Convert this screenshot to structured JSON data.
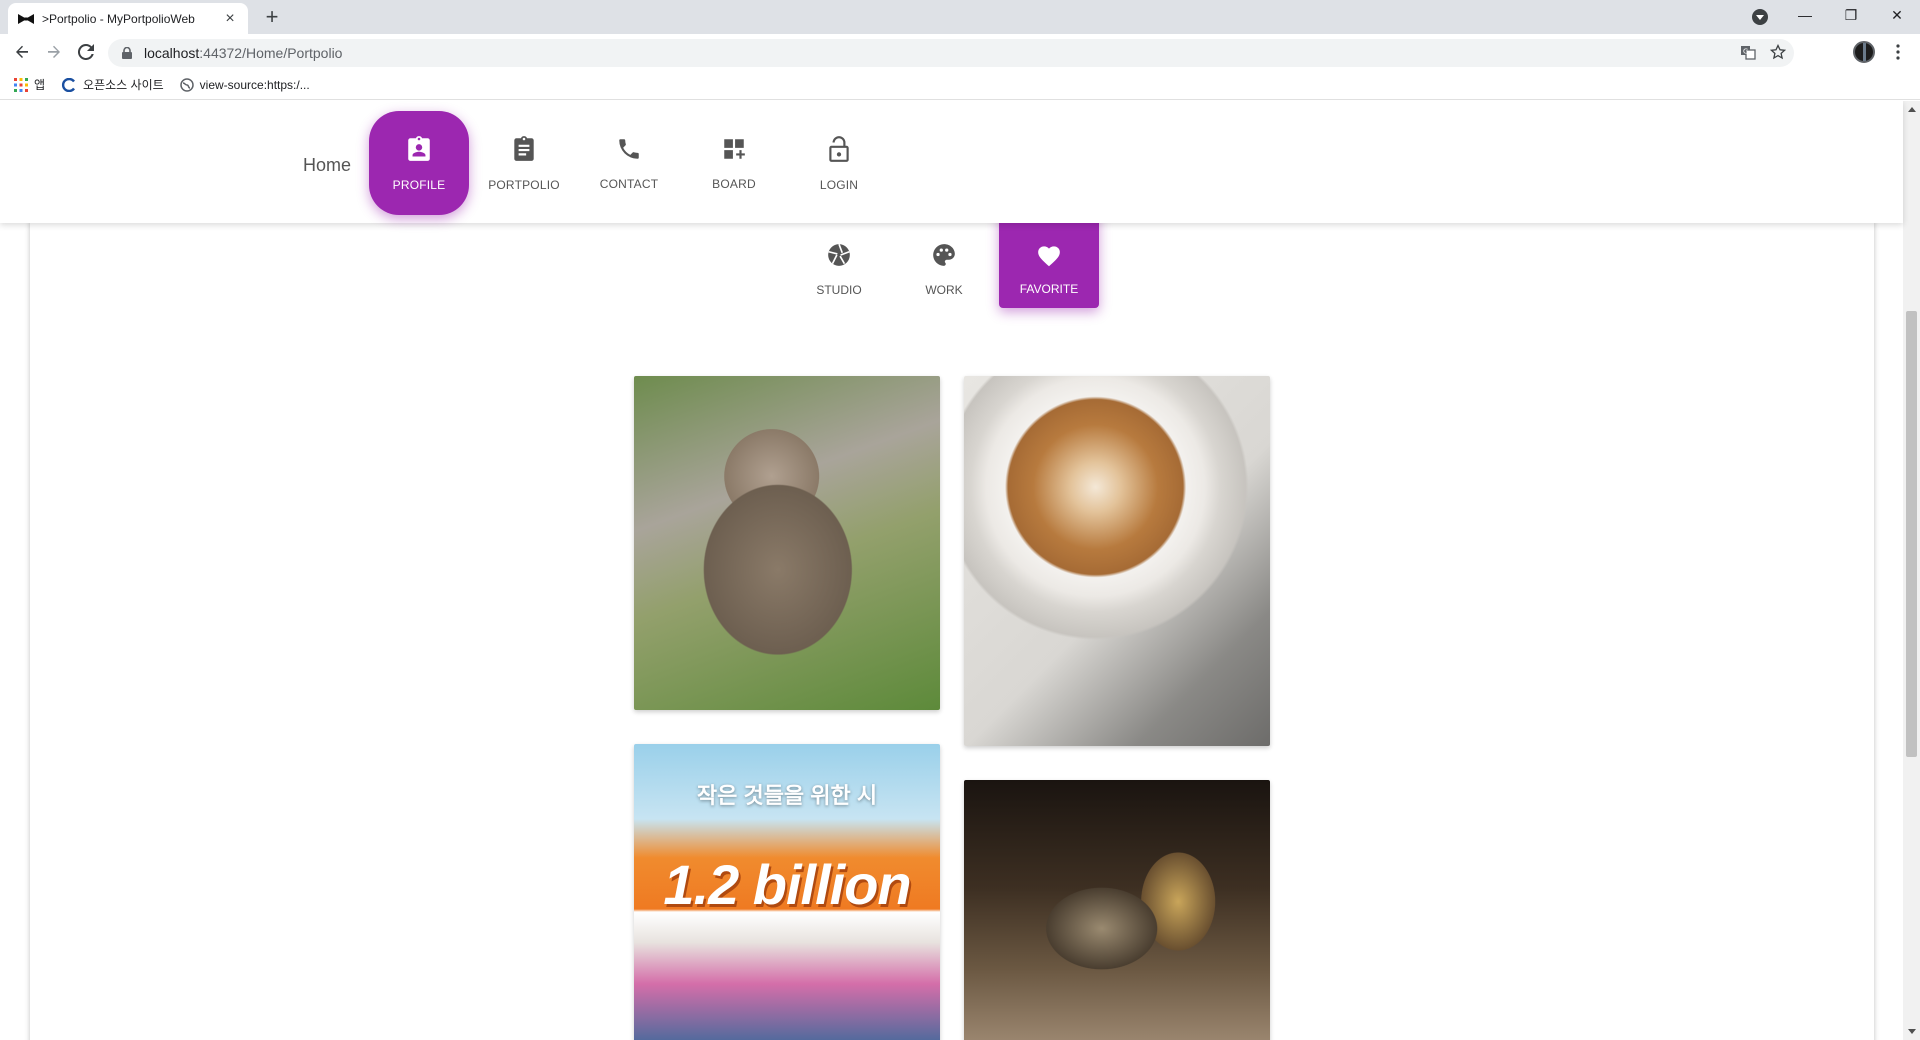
{
  "browser": {
    "tab_title": ">Portpolio - MyPortpolioWeb",
    "url_host": "localhost",
    "url_rest": ":44372/Home/Portpolio",
    "bookmarks": [
      "앱",
      "오픈소스 사이트",
      "view-source:https:/..."
    ]
  },
  "nav": {
    "home": "Home",
    "items": [
      {
        "label": "PROFILE",
        "icon": "contact-badge-icon",
        "active": true
      },
      {
        "label": "PORTPOLIO",
        "icon": "clipboard-icon",
        "active": false
      },
      {
        "label": "CONTACT",
        "icon": "phone-icon",
        "active": false
      },
      {
        "label": "BOARD",
        "icon": "dashboard-add-icon",
        "active": false
      },
      {
        "label": "LOGIN",
        "icon": "lock-open-icon",
        "active": false
      }
    ]
  },
  "subnav": {
    "items": [
      {
        "label": "STUDIO",
        "icon": "camera-aperture-icon",
        "active": false
      },
      {
        "label": "WORK",
        "icon": "palette-icon",
        "active": false
      },
      {
        "label": "FAVORITE",
        "icon": "heart-icon",
        "active": true
      }
    ]
  },
  "gallery": {
    "bts_line1": "작은 것들을 위한 시",
    "bts_line2": "1.2 billion"
  },
  "colors": {
    "accent": "#9c27b0"
  }
}
